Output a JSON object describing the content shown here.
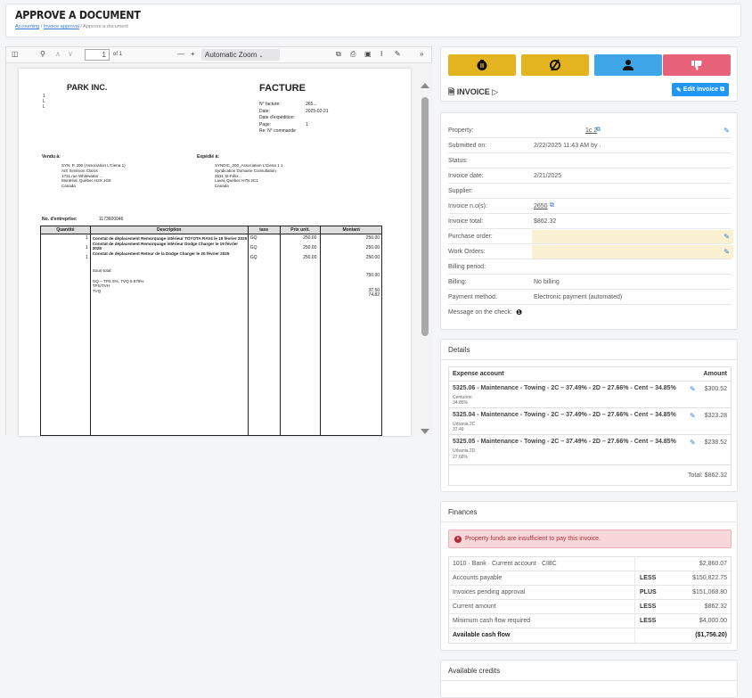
{
  "header": {
    "title": "APPROVE A DOCUMENT",
    "breadcrumb": [
      "Accounting",
      "Invoice approval",
      "Approve a document"
    ]
  },
  "pdf_viewer": {
    "page_current": "1",
    "page_total": "of 1",
    "zoom": "Automatic Zoom"
  },
  "document": {
    "company": "PARK INC.",
    "doc_type": "FACTURE",
    "meta": [
      {
        "label": "N° facture:",
        "value": "265..."
      },
      {
        "label": "Date:",
        "value": "2025-02-21"
      },
      {
        "label": "Date d'expédition:",
        "value": ""
      },
      {
        "label": "Page:",
        "value": "1"
      },
      {
        "label": "Re: N° commande",
        "value": ""
      }
    ],
    "sold_to_label": "Vendu à:",
    "sold_to": [
      "SYN. P. 200 (Association L'Ciena 1)",
      "A/S Sinvision Claros",
      "1731 rue Whitewater ...",
      "Montréal, Québec H2X 1G6",
      "Canada"
    ],
    "ship_to_label": "Expédié à:",
    "ship_to": [
      "SYNDIC_200_Association L'Ciena 1 1",
      "Syndication Domaine Consultation",
      "3531 St-Félix...",
      "Laval, Québec H7N 2C1",
      "Canada"
    ],
    "enterprise_label": "No. d'entreprise:",
    "enterprise_value": "1173600046",
    "table_headers": [
      "Quantité",
      "Description",
      "taxe",
      "Prix unit.",
      "Montant"
    ],
    "lines": [
      {
        "qty": "1",
        "desc": "Constat de déplacement Remorquage intérieur TOYOTA RAV4 le 19 février 2025",
        "tax": "GQ",
        "unit": "250.00",
        "amount": "250.00"
      },
      {
        "qty": "1",
        "desc": "Constat de déplacement Remorquage intérieur Dodge Charger le 19 février 2025",
        "tax": "GQ",
        "unit": "250.00",
        "amount": "250.00"
      },
      {
        "qty": "1",
        "desc": "Constat de déplacement Retour de la Dodge Charger le 20 février 2025",
        "tax": "GQ",
        "unit": "250.00",
        "amount": "250.00"
      }
    ],
    "subtotal_label": "Sous-total:",
    "subtotal": "750.00",
    "tax_desc": "GQ – TPS 5%, TVQ 9.975%",
    "tax_lines": [
      {
        "label": "TPS/TVH",
        "value": "37.50"
      },
      {
        "label": "TVQ",
        "value": "74.82"
      }
    ]
  },
  "actions": {
    "colors": {
      "hold": "#e3b420",
      "cancel": "#e3b420",
      "assign": "#3fa6e8",
      "reject": "#e8637a"
    },
    "invoice_title": "INVOICE",
    "edit_label": "Edit invoice"
  },
  "info": {
    "rows": [
      {
        "label": "Property:",
        "value": "",
        "link": "1c 2"
      },
      {
        "label": "Submitted on:",
        "value": "2/22/2025 11:43 AM by ."
      },
      {
        "label": "Status:",
        "value": ""
      },
      {
        "label": "Invoice date:",
        "value": "2/21/2025"
      },
      {
        "label": "Supplier:",
        "value": ""
      },
      {
        "label": "Invoice n.o(s):",
        "value": "",
        "link": "2650"
      },
      {
        "label": "Invoice total:",
        "value": "$862.32"
      },
      {
        "label": "Purchase order:",
        "value": ""
      },
      {
        "label": "Work Orders:",
        "value": ""
      },
      {
        "label": "Billing period:",
        "value": ""
      },
      {
        "label": "Billing:",
        "value": "No billing"
      },
      {
        "label": "Payment method:",
        "value": "Electronic payment (automated)"
      },
      {
        "label": "Message on the check:",
        "value": ""
      }
    ]
  },
  "details": {
    "title": "Details",
    "col_account": "Expense account",
    "col_amount": "Amount",
    "rows": [
      {
        "account": "5325.06 - Maintenance - Towing - 2C – 37.49% - 2D – 27.66% - Cent – 34.85%",
        "sub1": "Centurion",
        "sub2": "34.85%",
        "amount": "$300.52"
      },
      {
        "account": "5325.04 - Maintenance - Towing - 2C – 37.49% - 2D – 27.66% - Cent – 34.85%",
        "sub1": "Urbania 2C",
        "sub2": "37.49",
        "amount": "$323.28"
      },
      {
        "account": "5325.05 - Maintenance - Towing - 2C – 37.49% - 2D – 27.66% - Cent – 34.85%",
        "sub1": "Urbania 2D",
        "sub2": "27.66%",
        "amount": "$238.52"
      }
    ],
    "total_label": "Total:",
    "total": "$862.32"
  },
  "finances": {
    "title": "Finances",
    "alert": "Property funds are insufficient to pay this invoice.",
    "rows": [
      {
        "label": "1010 · Bank · Current account · CIBC",
        "mod": "",
        "amount": "$2,860.07"
      },
      {
        "label": "Accounts payable",
        "mod": "LESS",
        "amount": "$150,822.75"
      },
      {
        "label": "Invoices pending approval",
        "mod": "PLUS",
        "amount": "$151,068.80"
      },
      {
        "label": "Current amount",
        "mod": "LESS",
        "amount": "$862.32"
      },
      {
        "label": "Minimum cash flow required",
        "mod": "LESS",
        "amount": "$4,000.00"
      },
      {
        "label": "Available cash flow",
        "mod": "",
        "amount": "($1,756.20)"
      }
    ]
  },
  "credits": {
    "title": "Available credits"
  }
}
